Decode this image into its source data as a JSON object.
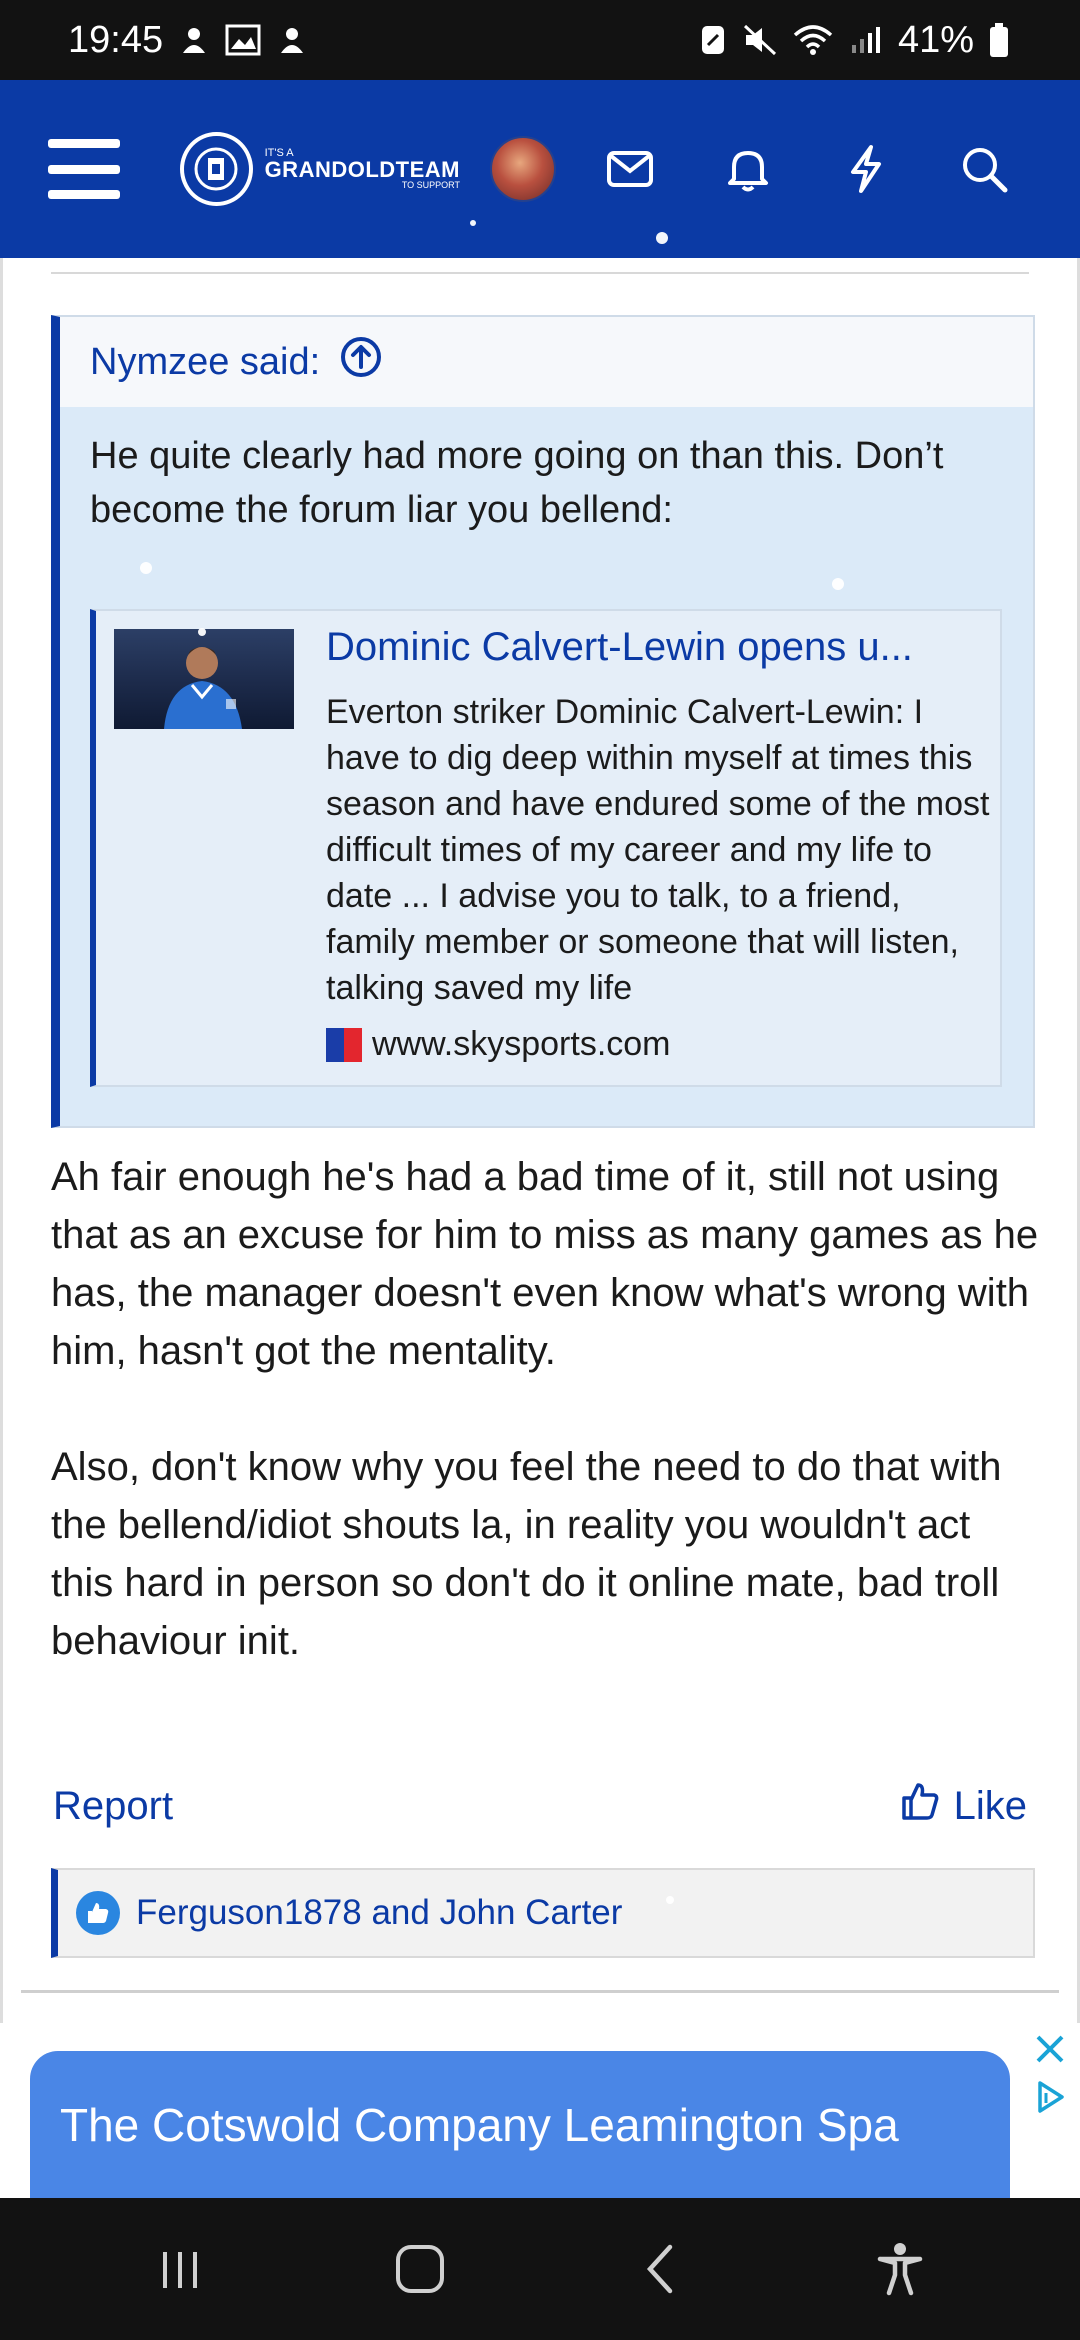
{
  "status_bar": {
    "time": "19:45",
    "battery": "41%"
  },
  "header": {
    "logo": {
      "small_text": "IT'S A",
      "brand": "GRANDOLDTEAM",
      "tagline": "TO SUPPORT"
    },
    "icons": [
      "menu-icon",
      "mail-icon",
      "bell-icon",
      "lightning-icon",
      "search-icon"
    ]
  },
  "quote": {
    "author_said": "Nymzee said:",
    "text": "He quite clearly had more going on than this. Don’t become the forum liar you bellend:",
    "embed": {
      "title": "Dominic Calvert-Lewin opens u...",
      "description": "Everton striker Dominic Calvert-Lewin: I have to dig deep within myself at times this season and have endured some of the most difficult times of my career and my life to date ... I advise you to talk, to a friend, family member or someone that will listen, talking saved my life",
      "source": "www.skysports.com"
    }
  },
  "post": {
    "paragraphs": [
      "Ah fair enough he's had a bad time of it, still not using that as an excuse for him to miss as many games as he has, the manager doesn't even know what's wrong with him, hasn't got the mentality.",
      "Also, don't know why you feel the need to do that with the bellend/idiot shouts la, in reality you wouldn't act this hard in person so don't do it online mate, bad troll behaviour init."
    ],
    "report_label": "Report",
    "like_label": "Like",
    "likes_text": "Ferguson1878 and John Carter"
  },
  "ad": {
    "text": "The Cotswold Company Leamington Spa"
  },
  "colors": {
    "brand_blue": "#0b3aa5",
    "quote_bg": "#dbeaf8",
    "ad_blue": "#4a86e6"
  }
}
